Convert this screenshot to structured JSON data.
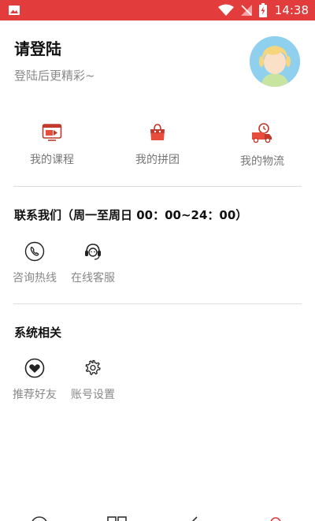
{
  "status_bar": {
    "time": "14:38",
    "icons": [
      "image-icon",
      "wifi-icon",
      "signal-off-icon",
      "battery-charging-icon"
    ]
  },
  "profile": {
    "title": "请登陆",
    "subtitle": "登陆后更精彩~"
  },
  "quick_actions": [
    {
      "label": "我的课程",
      "icon": "video-course-icon"
    },
    {
      "label": "我的拼团",
      "icon": "shopping-bag-icon"
    },
    {
      "label": "我的物流",
      "icon": "delivery-truck-icon"
    }
  ],
  "contact": {
    "title": "联系我们（周一至周日 00：00~24：00）",
    "items": [
      {
        "label": "咨询热线",
        "icon": "phone-icon"
      },
      {
        "label": "在线客服",
        "icon": "headset-icon"
      }
    ]
  },
  "system": {
    "title": "系统相关",
    "items": [
      {
        "label": "推荐好友",
        "icon": "heart-icon"
      },
      {
        "label": "账号设置",
        "icon": "gear-icon"
      }
    ]
  },
  "bottom_nav": {
    "icons": [
      "home-icon",
      "grid-icon",
      "edit-icon",
      "profile-icon"
    ]
  },
  "colors": {
    "accent": "#e23c3c",
    "divider": "#dcdcdc",
    "avatar_bg": "#8fd0ee"
  }
}
